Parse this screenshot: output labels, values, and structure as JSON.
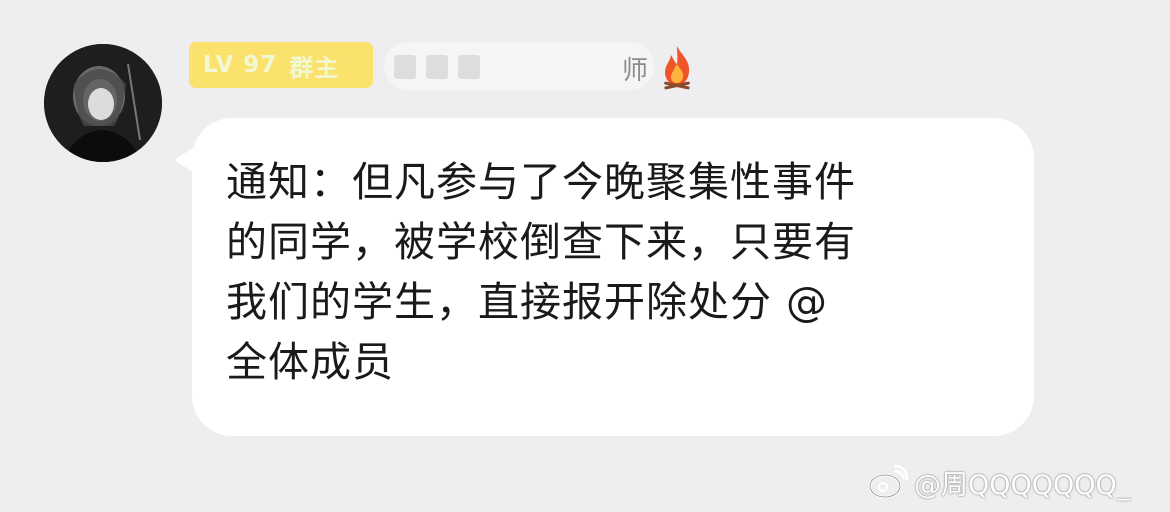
{
  "sender": {
    "level": "LV 97",
    "role": "群主",
    "name_visible_suffix": "师",
    "fire_icon": "fire-icon"
  },
  "message": {
    "text": "通知：但凡参与了今晚聚集性事件\n的同学，被学校倒查下来，只要有\n我们的学生，直接报开除处分 @\n全体成员"
  },
  "watermark": {
    "text": "@周QQQQQQQ_",
    "icon": "weibo-icon"
  },
  "colors": {
    "background": "#eeeef0",
    "badge": "#fbe26c",
    "bubble": "#ffffff",
    "text": "#1a1a1a"
  }
}
